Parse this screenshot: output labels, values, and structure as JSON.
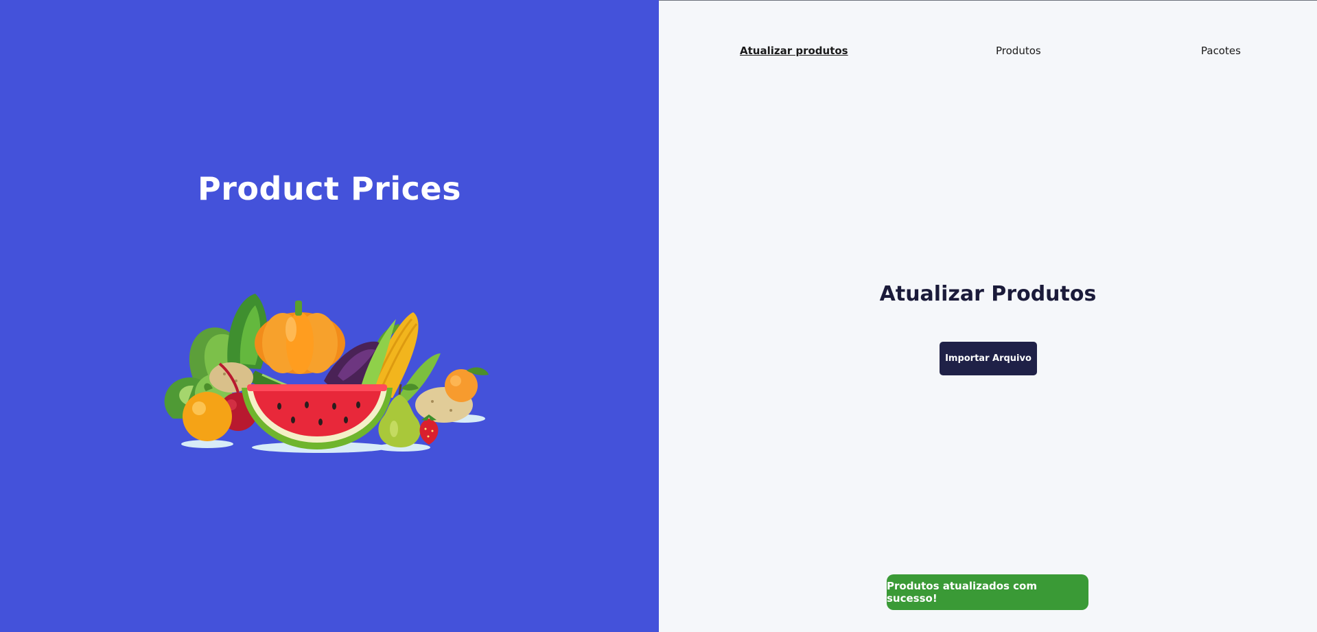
{
  "colors": {
    "brand_panel_bg": "#4452da",
    "content_bg": "#f5f7fa",
    "title_color": "#1b1b3a",
    "button_bg": "#1f2147",
    "toast_bg": "#3a9a36"
  },
  "brand": {
    "title": "Product Prices",
    "illustration": "fruits-and-vegetables-illustration"
  },
  "nav": {
    "items": [
      {
        "label": "Atualizar produtos",
        "active": true
      },
      {
        "label": "Produtos",
        "active": false
      },
      {
        "label": "Pacotes",
        "active": false
      }
    ]
  },
  "main": {
    "title": "Atualizar Produtos",
    "import_button_label": "Importar Arquivo"
  },
  "toast": {
    "message": "Produtos atualizados com sucesso!"
  }
}
